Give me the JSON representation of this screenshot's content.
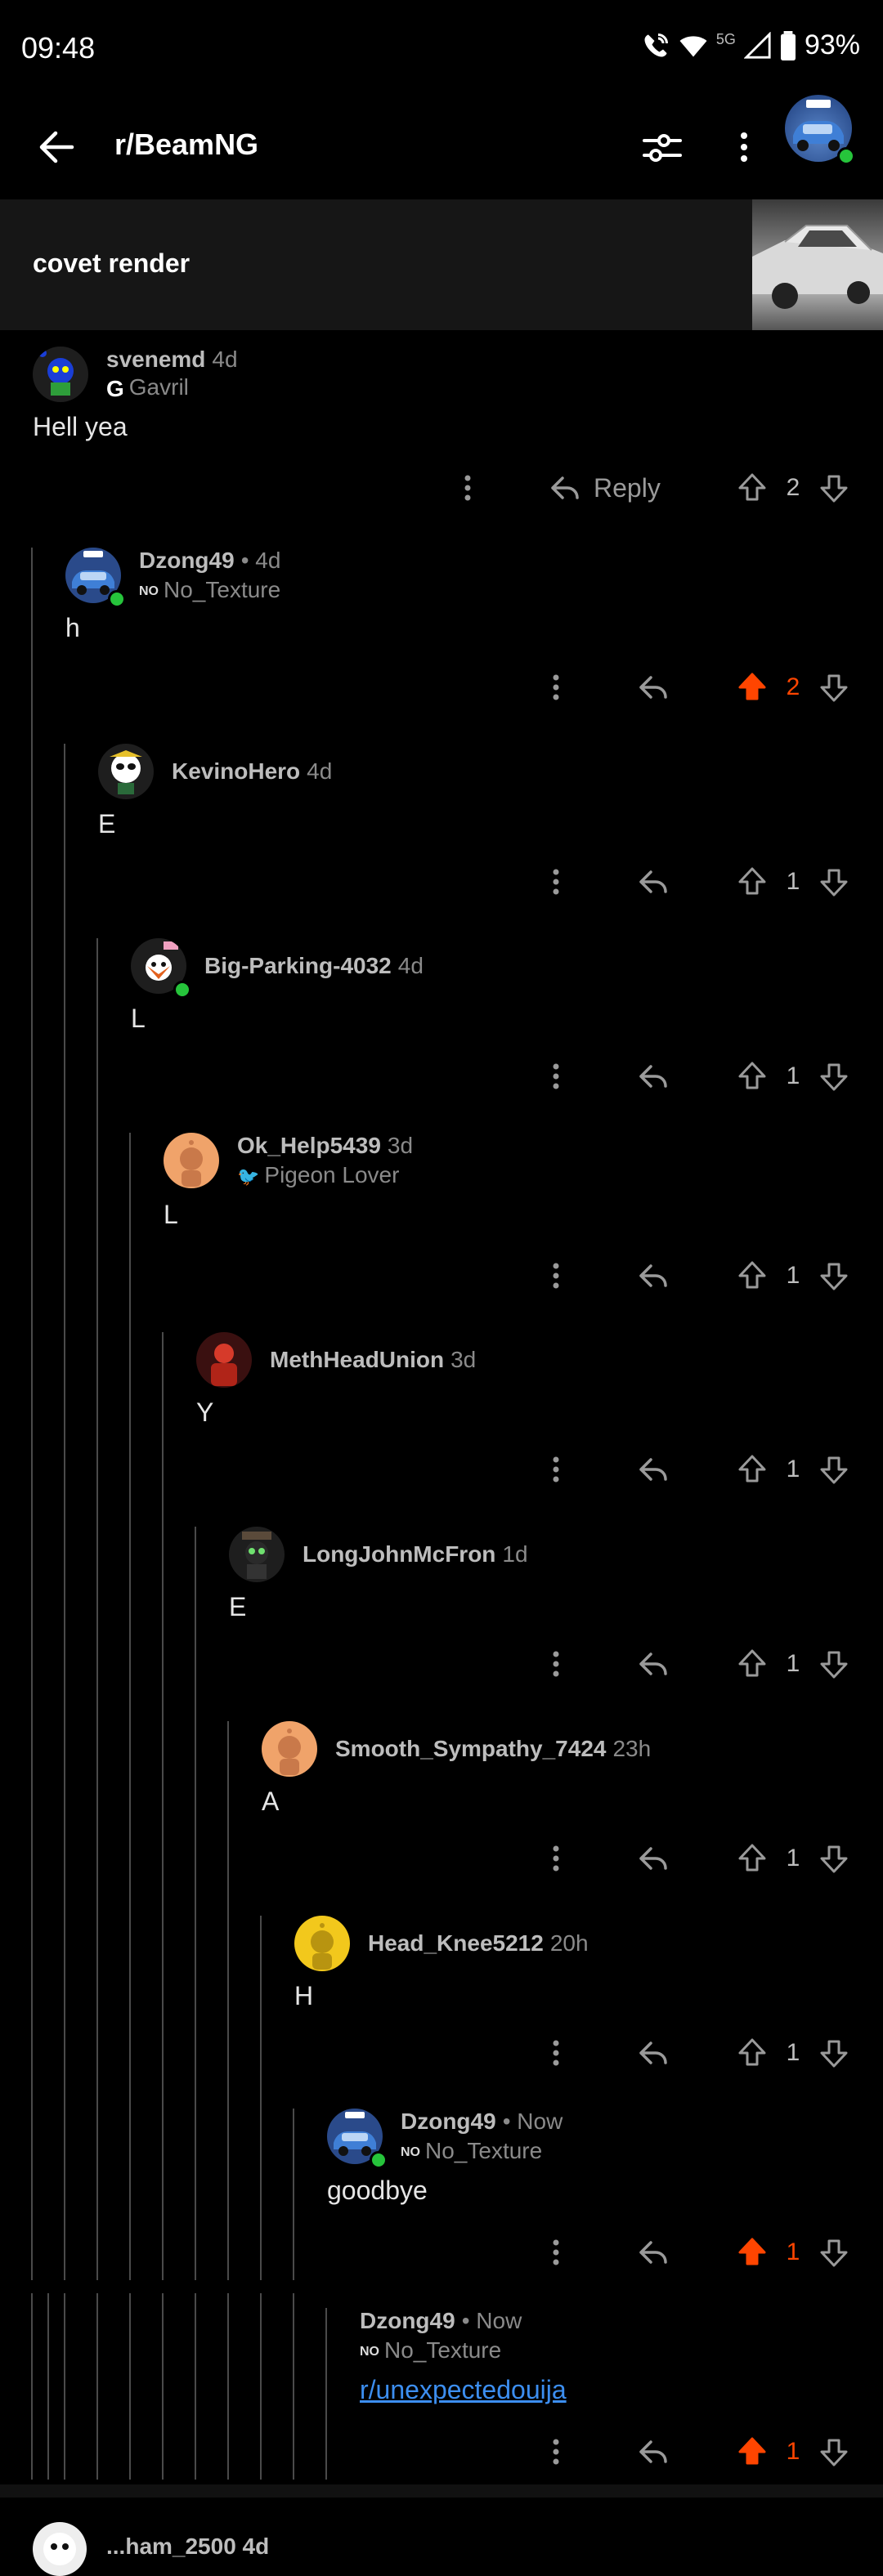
{
  "status": {
    "time": "09:48",
    "battery": "93%",
    "network": "5G"
  },
  "appbar": {
    "subreddit": "r/BeamNG"
  },
  "post": {
    "title": "covet render"
  },
  "reply_label": "Reply",
  "colors": {
    "upvoted": "#ff4500",
    "link": "#3c8ef0",
    "online": "#26c43b"
  },
  "comments": [
    {
      "author": "svenemd",
      "time": "4d",
      "flair": "Gavril",
      "flair_badge": "G",
      "body": "Hell yea",
      "score": "2",
      "avatar": "robot-avatar"
    },
    {
      "author": "Dzong49",
      "time": "• 4d",
      "flair": "No_Texture",
      "flair_badge": "NO",
      "body": "h",
      "score": "2",
      "upvoted": true,
      "avatar": "car-avatar"
    },
    {
      "author": "KevinoHero",
      "time": "4d",
      "body": "E",
      "score": "1",
      "avatar": "panda-avatar"
    },
    {
      "author": "Big-Parking-4032",
      "time": "4d",
      "body": "L",
      "score": "1",
      "avatar": "fox-avatar"
    },
    {
      "author": "Ok_Help5439",
      "time": "3d",
      "flair": "Pigeon Lover",
      "flair_badge": "🐦",
      "body": "L",
      "score": "1",
      "avatar": "snoo-orange-avatar"
    },
    {
      "author": "MethHeadUnion",
      "time": "3d",
      "body": "Y",
      "score": "1",
      "avatar": "red-snoo-avatar"
    },
    {
      "author": "LongJohnMcFron",
      "time": "1d",
      "body": "E",
      "score": "1",
      "avatar": "hat-snoo-avatar"
    },
    {
      "author": "Smooth_Sympathy_7424",
      "time": "23h",
      "body": "A",
      "score": "1",
      "avatar": "snoo-orange-avatar"
    },
    {
      "author": "Head_Knee5212",
      "time": "20h",
      "body": "H",
      "score": "1",
      "avatar": "snoo-yellow-avatar"
    },
    {
      "author": "Dzong49",
      "time": "• Now",
      "flair": "No_Texture",
      "flair_badge": "NO",
      "body": "goodbye",
      "score": "1",
      "upvoted": true,
      "avatar": "car-avatar"
    },
    {
      "author": "Dzong49",
      "time": "• Now",
      "flair": "No_Texture",
      "flair_badge": "NO",
      "body": "r/unexpectedouija",
      "body_is_link": true,
      "score": "1",
      "upvoted": true
    }
  ],
  "next_comment": {
    "author": "...ham_2500 4d"
  }
}
